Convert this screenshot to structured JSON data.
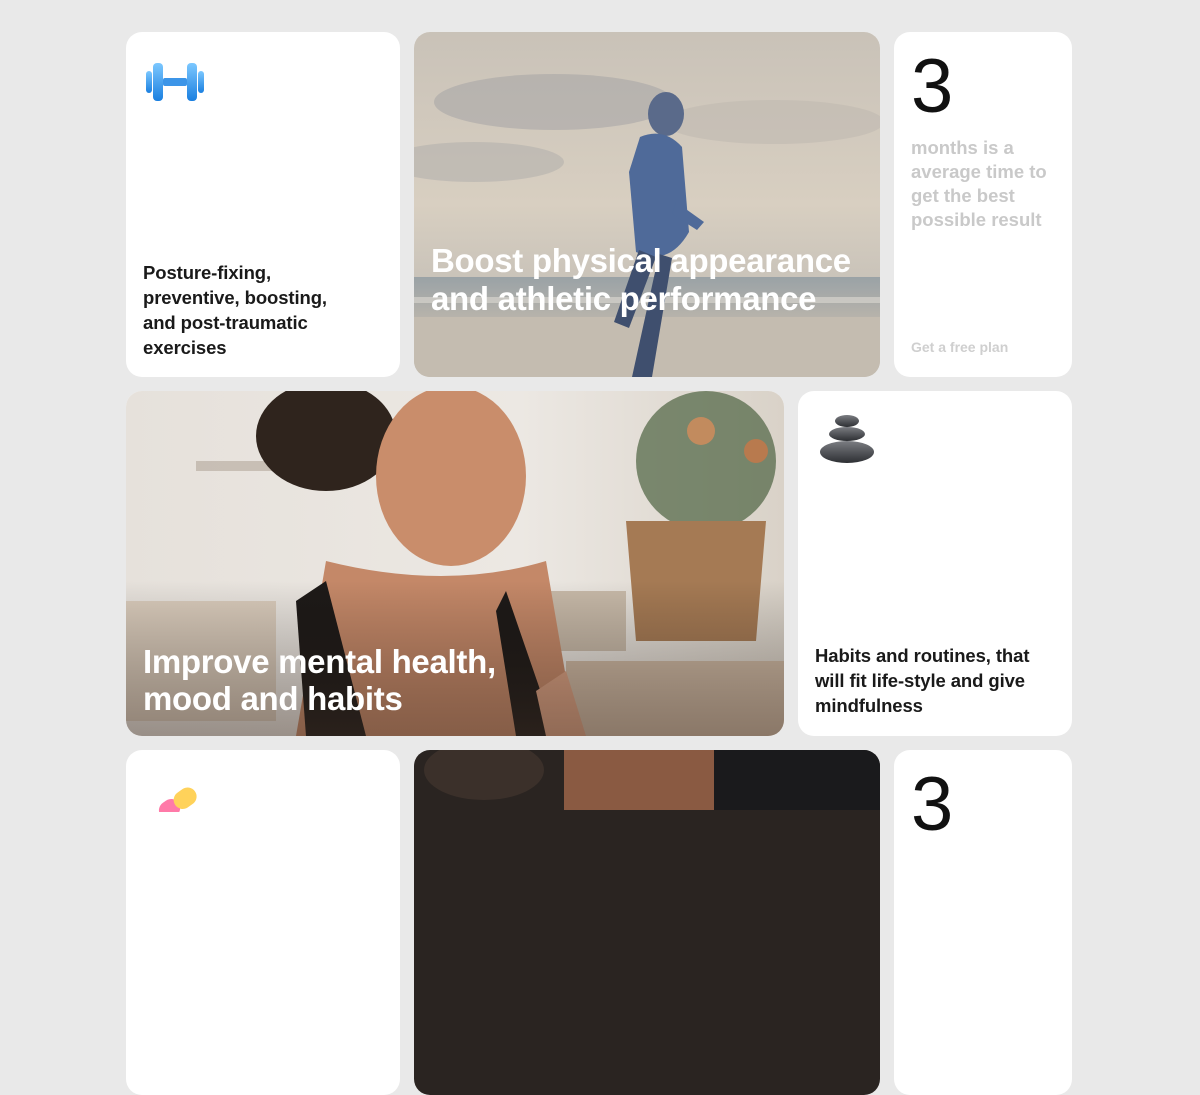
{
  "cards": {
    "exercises": {
      "icon": "dumbbell-icon",
      "text": "Posture-fixing, preventive, boosting, and post-traumatic exercises"
    },
    "physical": {
      "image": "runner-on-beach",
      "title": "Boost physical appearance and athletic performance"
    },
    "stat_top": {
      "number": "3",
      "description": "months is a average time to get the best possible result",
      "link": "Get a free plan"
    },
    "mental": {
      "image": "woman-meditating",
      "title": "Improve mental health, mood and habits"
    },
    "habits": {
      "icon": "stacked-stones-icon",
      "text": "Habits and routines, that will fit life-style and give mindfulness"
    },
    "bottom_left": {
      "icon": "pill-icon"
    },
    "bottom_middle": {
      "image": "dark-photo"
    },
    "stat_bottom": {
      "number": "3"
    }
  },
  "colors": {
    "background": "#e9e9e9",
    "card": "#ffffff",
    "text": "#1a1a1a",
    "muted": "#c9c9c9"
  }
}
